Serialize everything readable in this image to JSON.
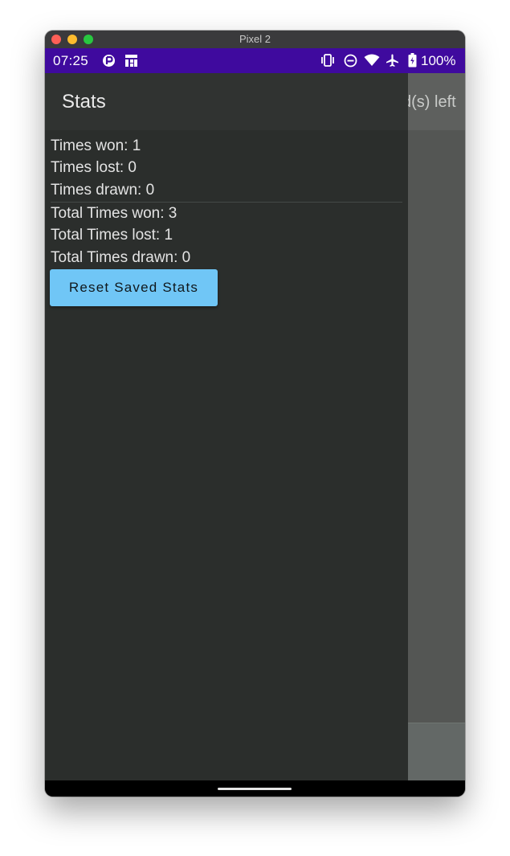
{
  "window": {
    "title": "Pixel 2"
  },
  "status_bar": {
    "time": "07:25",
    "battery": "100%",
    "icons": [
      "notification-app-icon",
      "notification-app-icon-2",
      "vibrate-icon",
      "do-not-disturb-icon",
      "wifi-icon",
      "airplane-mode-icon",
      "battery-icon"
    ]
  },
  "background": {
    "appbar_text": "d(s) left"
  },
  "drawer": {
    "title": "Stats",
    "stats": [
      "Times won: 1",
      "Times lost: 0",
      "Times drawn: 0"
    ],
    "totals": [
      "Total Times won: 3",
      "Total Times lost: 1",
      "Total Times drawn: 0"
    ],
    "reset_button": "Reset Saved Stats"
  },
  "colors": {
    "status_bar": "#3f0a9e",
    "drawer": "#2b2e2c",
    "button": "#70c6f6"
  }
}
